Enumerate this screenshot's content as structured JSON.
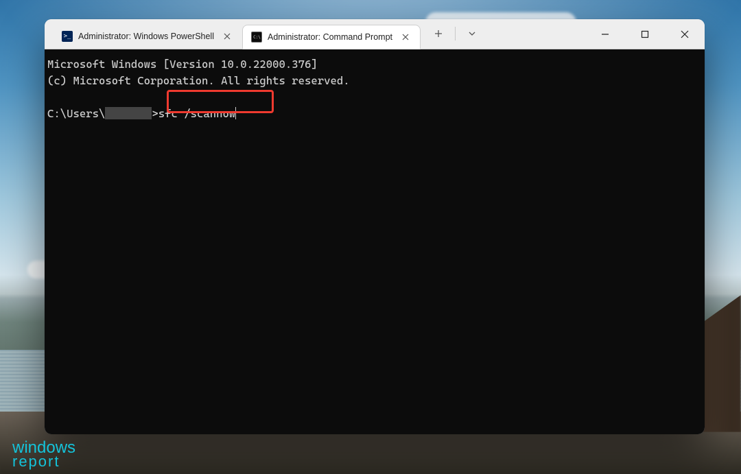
{
  "tabs": {
    "inactive": {
      "label": "Administrator: Windows PowerShell"
    },
    "active": {
      "label": "Administrator: Command Prompt"
    }
  },
  "terminal": {
    "line1": "Microsoft Windows [Version 10.0.22000.376]",
    "line2": "(c) Microsoft Corporation. All rights reserved.",
    "prompt_prefix": "C:\\Users\\",
    "prompt_suffix": ">",
    "command": "sfc /scannow"
  },
  "watermark": {
    "line1": "windows",
    "line2": "report"
  }
}
